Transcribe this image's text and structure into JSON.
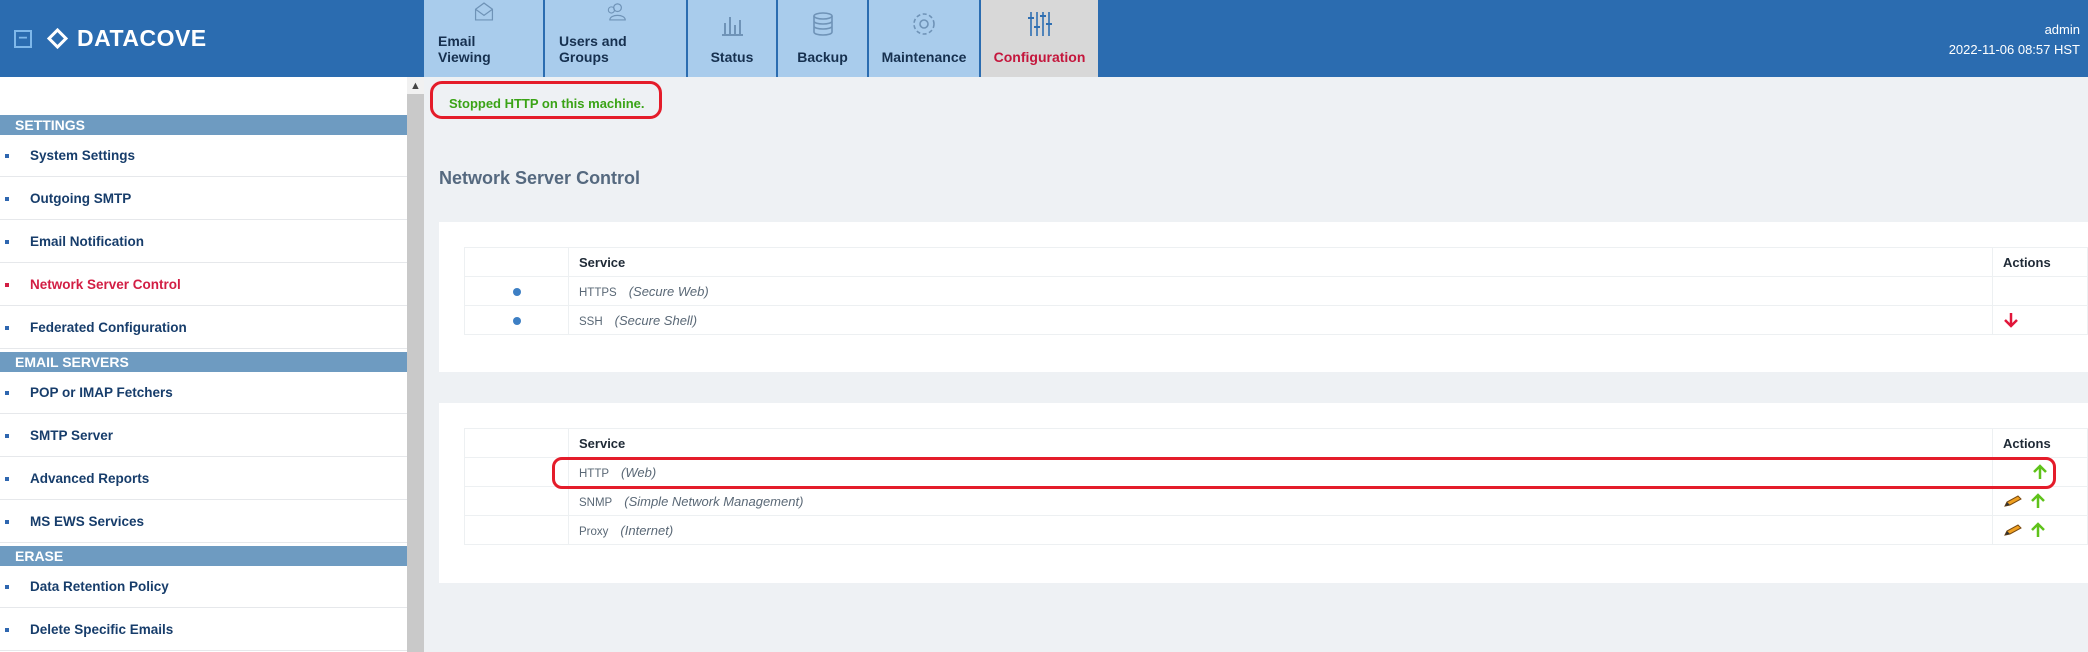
{
  "app": {
    "brand": "DATACOVE",
    "collapse_symbol": "−"
  },
  "header": {
    "tabs": [
      {
        "label": "Email Viewing",
        "icon": "envelope-icon"
      },
      {
        "label": "Users and Groups",
        "icon": "users-icon"
      },
      {
        "label": "Status",
        "icon": "bar-chart-icon"
      },
      {
        "label": "Backup",
        "icon": "database-icon"
      },
      {
        "label": "Maintenance",
        "icon": "gear-icon"
      },
      {
        "label": "Configuration",
        "icon": "sliders-icon",
        "active": true
      }
    ],
    "user": "admin",
    "datetime": "2022-11-06 08:57 HST"
  },
  "sidebar": {
    "sections": [
      {
        "title": "SETTINGS",
        "items": [
          {
            "label": "System Settings"
          },
          {
            "label": "Outgoing SMTP"
          },
          {
            "label": "Email Notification"
          },
          {
            "label": "Network Server Control",
            "active": true
          },
          {
            "label": "Federated Configuration"
          }
        ]
      },
      {
        "title": "EMAIL SERVERS",
        "items": [
          {
            "label": "POP or IMAP Fetchers"
          },
          {
            "label": "SMTP Server"
          },
          {
            "label": "Advanced Reports"
          },
          {
            "label": "MS EWS Services"
          }
        ]
      },
      {
        "title": "ERASE",
        "items": [
          {
            "label": "Data Retention Policy"
          },
          {
            "label": "Delete Specific Emails"
          }
        ]
      }
    ]
  },
  "main": {
    "status_message": "Stopped HTTP on this machine.",
    "page_title": "Network Server Control",
    "running_table": {
      "header_service": "Service",
      "header_actions": "Actions",
      "rows": [
        {
          "name": "HTTPS",
          "desc": "(Secure Web)",
          "actions": []
        },
        {
          "name": "SSH",
          "desc": "(Secure Shell)",
          "actions": [
            "stop-arrow-icon"
          ]
        }
      ]
    },
    "stopped_table": {
      "header_service": "Service",
      "header_actions": "Actions",
      "rows": [
        {
          "name": "HTTP",
          "desc": "(Web)",
          "actions": [
            "start-arrow-icon"
          ]
        },
        {
          "name": "SNMP",
          "desc": "(Simple Network Management)",
          "actions": [
            "edit-pencil-icon",
            "start-arrow-icon"
          ]
        },
        {
          "name": "Proxy",
          "desc": "(Internet)",
          "actions": [
            "edit-pencil-icon",
            "start-arrow-icon"
          ]
        }
      ]
    }
  },
  "colors": {
    "header_bg": "#2b6cb0",
    "tab_bg": "#a9ccec",
    "active_tab_bg": "#d8d8d8",
    "active_accent": "#c4163c",
    "section_head_bg": "#6e9bc1",
    "success_text": "#3aa316",
    "highlight_oval": "#e41c2a"
  }
}
